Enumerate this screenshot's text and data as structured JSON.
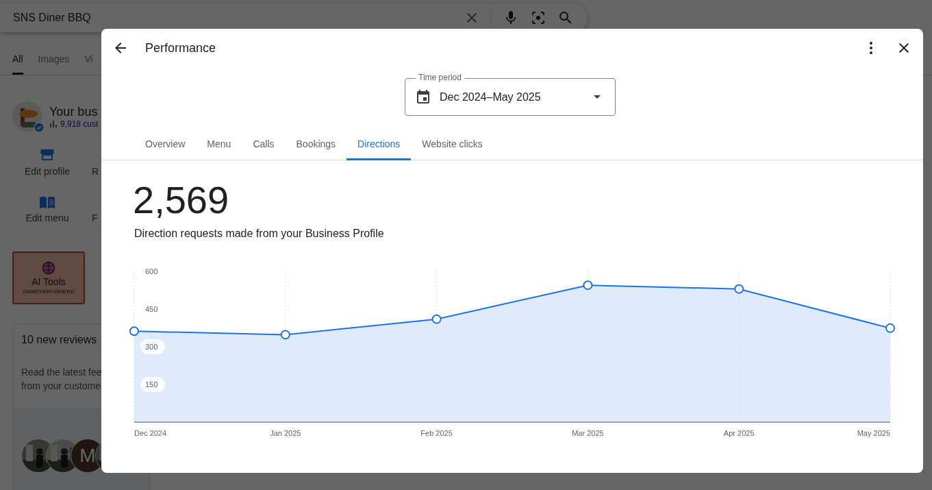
{
  "search": {
    "value": "SNS Diner BBQ"
  },
  "search_tabs": [
    {
      "label": "All",
      "selected": true
    },
    {
      "label": "Images",
      "selected": false
    },
    {
      "label": "Vi",
      "selected": false
    }
  ],
  "business": {
    "title": "Your bus",
    "stat": "9,918 cust",
    "verified": true
  },
  "actions": [
    {
      "label": "Edit profile",
      "kind": "store"
    },
    {
      "label": "R",
      "kind": "none"
    },
    {
      "label": "Edit menu",
      "kind": "menu"
    },
    {
      "label": "F",
      "kind": "none"
    }
  ],
  "ai_tools": {
    "title": "AI Tools",
    "subtitle": "GMBEVERYWHERE"
  },
  "reviews": {
    "title": "10 new reviews",
    "text_lines": [
      "Read the latest fee",
      "from your custome"
    ],
    "avatars": [
      {
        "kind": "picture"
      },
      {
        "kind": "picture"
      },
      {
        "kind": "letter",
        "letter": "M"
      },
      {
        "kind": "picture"
      }
    ]
  },
  "dialog": {
    "title": "Performance",
    "time_period": {
      "label": "Time period",
      "value": "Dec 2024–May 2025"
    },
    "tabs": [
      {
        "label": "Overview",
        "selected": false
      },
      {
        "label": "Menu",
        "selected": false
      },
      {
        "label": "Calls",
        "selected": false
      },
      {
        "label": "Bookings",
        "selected": false
      },
      {
        "label": "Directions",
        "selected": true
      },
      {
        "label": "Website clicks",
        "selected": false
      }
    ],
    "total": "2,569",
    "description": "Direction requests made from your Business Profile",
    "chart_data": {
      "type": "area",
      "categories": [
        "Dec 2024",
        "Jan 2025",
        "Feb 2025",
        "Mar 2025",
        "Apr 2025",
        "May 2025"
      ],
      "series": [
        {
          "color": "#1a73e8",
          "values": [
            362,
            348,
            410,
            545,
            530,
            374
          ]
        }
      ],
      "grid": true,
      "ylim": [
        0,
        600
      ],
      "yticks": [
        150,
        300,
        450,
        600
      ]
    }
  }
}
